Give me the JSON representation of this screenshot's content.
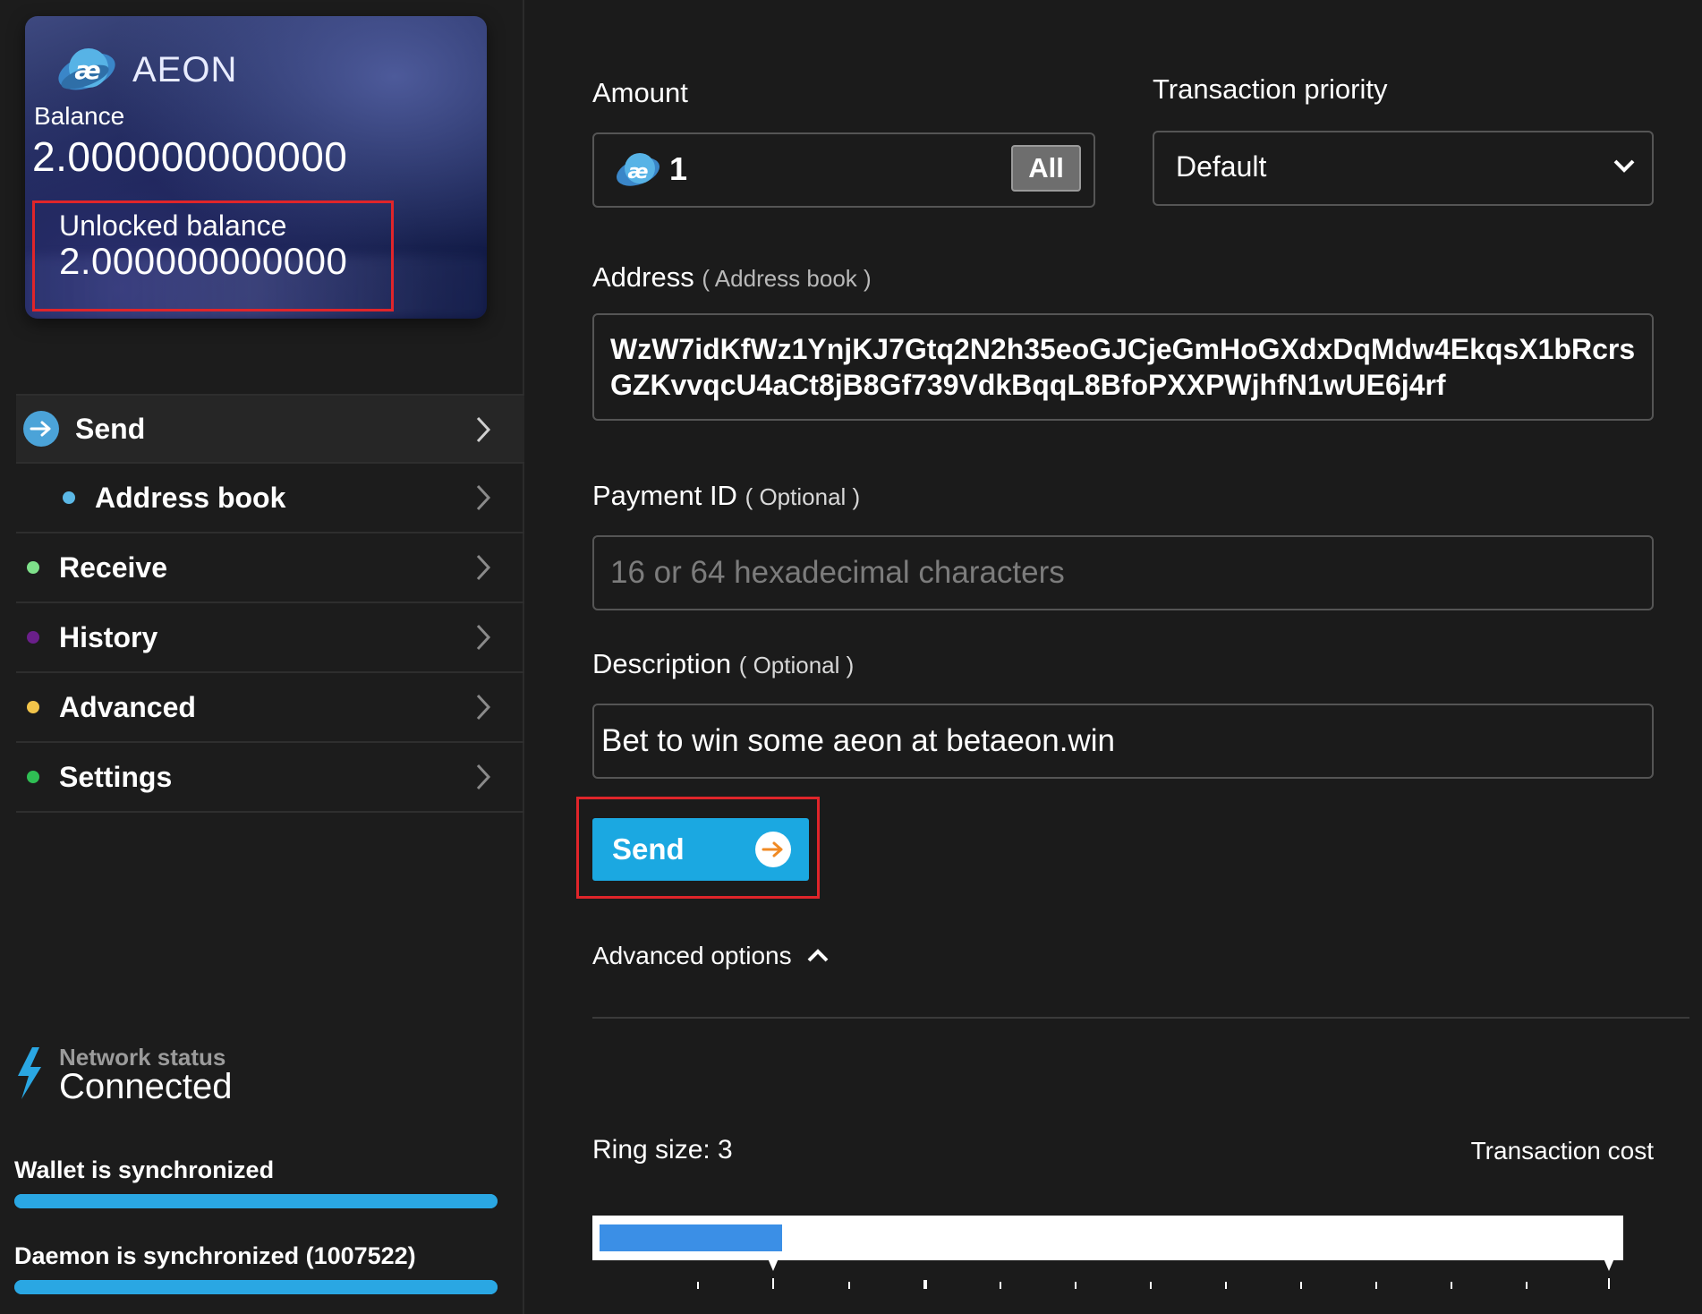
{
  "wallet": {
    "brand": "AEON",
    "balance_label": "Balance",
    "balance_value": "2.000000000000",
    "unlocked_label": "Unlocked balance",
    "unlocked_value": "2.000000000000",
    "logo_glyph": "æ"
  },
  "sidebar": {
    "items": [
      {
        "label": "Send",
        "color": "#4ba3d8"
      },
      {
        "label": "Address book",
        "color": "#5bb8e6"
      },
      {
        "label": "Receive",
        "color": "#7ee08a"
      },
      {
        "label": "History",
        "color": "#6a1f8a"
      },
      {
        "label": "Advanced",
        "color": "#f2c44a"
      },
      {
        "label": "Settings",
        "color": "#2fbf54"
      }
    ]
  },
  "network": {
    "label": "Network status",
    "value": "Connected"
  },
  "sync": {
    "wallet_label": "Wallet is synchronized",
    "wallet_progress": 1.0,
    "daemon_label": "Daemon is synchronized (1007522)",
    "daemon_progress": 1.0
  },
  "form": {
    "amount_label": "Amount",
    "amount_value": "1",
    "all_button": "All",
    "priority_label": "Transaction priority",
    "priority_value": "Default",
    "address_label": "Address",
    "address_book_link": "( Address book )",
    "address_value": "WzW7idKfWz1YnjKJ7Gtq2N2h35eoGJCjeGmHoGXdxDqMdw4EkqsX1bRcrsGZKvvqcU4aCt8jB8Gf739VdkBqqL8BfoPXXPWjhfN1wUE6j4rf",
    "payment_id_label": "Payment ID",
    "payment_id_optional": "( Optional )",
    "payment_id_placeholder": "16 or 64 hexadecimal characters",
    "description_label": "Description",
    "description_optional": "( Optional )",
    "description_value": "Bet to win some aeon at betaeon.win",
    "send_button": "Send",
    "advanced_options": "Advanced options",
    "ring_size_label": "Ring size: 3",
    "transaction_cost_label": "Transaction cost"
  },
  "colors": {
    "accent": "#1ba8e1",
    "highlight": "#e0252a",
    "send_arrow": "#f08a24"
  }
}
